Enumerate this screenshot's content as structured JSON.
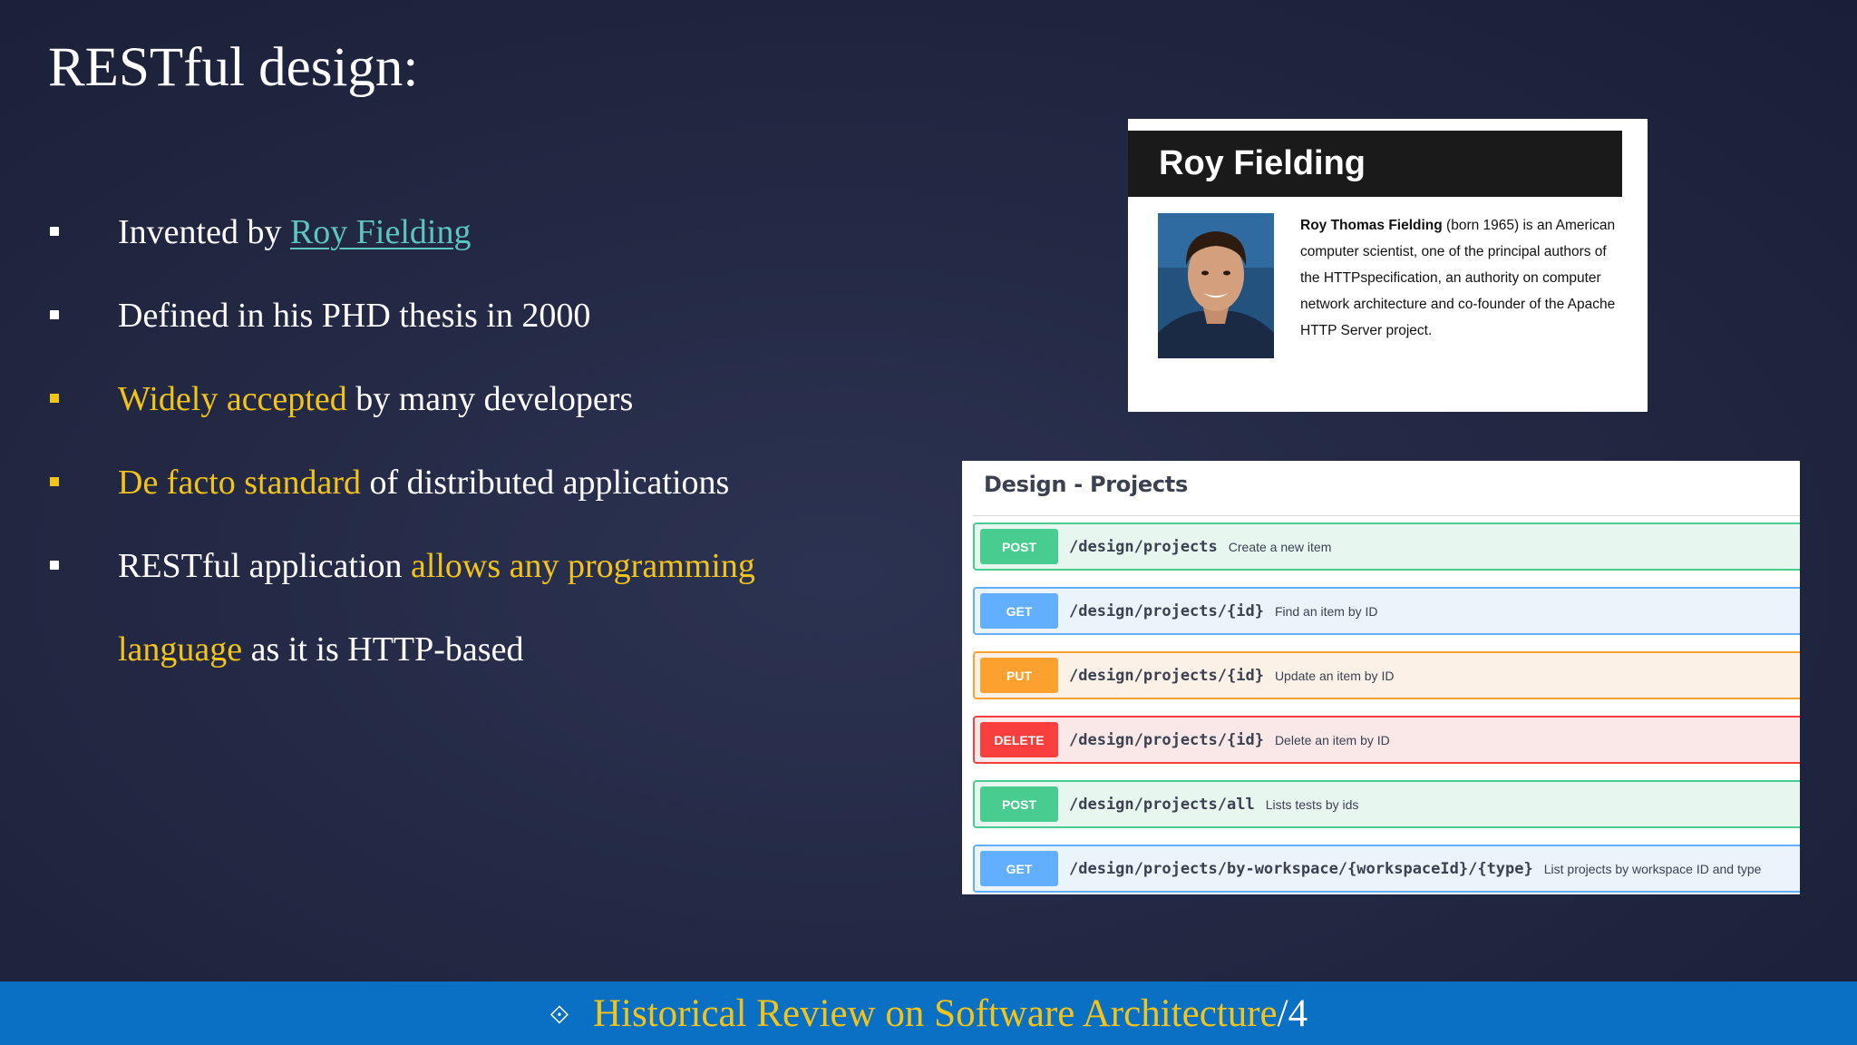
{
  "slide": {
    "title": "RESTful design:"
  },
  "bullets": {
    "b1": {
      "text": "Invented by ",
      "link": "Roy Fielding"
    },
    "b2": {
      "text": "Defined in his PHD thesis in 2000"
    },
    "b3": {
      "hl": "Widely accepted",
      "text": " by many developers"
    },
    "b4": {
      "hl": "De facto standard",
      "text": " of distributed applications"
    },
    "b5": {
      "text": "RESTful application ",
      "hl": "allows any programming"
    },
    "b6": {
      "hl": "language",
      "text": " as it is HTTP-based"
    }
  },
  "wiki_card": {
    "header": "Roy Fielding",
    "name_bold": "Roy Thomas Fielding",
    "description": " (born 1965) is an American computer scientist, one of the principal authors of the HTTPspecification, an authority on computer network architecture and co-founder of the Apache HTTP Server project."
  },
  "api_panel": {
    "title": "Design - Projects",
    "endpoints": [
      {
        "method": "POST",
        "path": "/design/projects",
        "desc": "Create a new item"
      },
      {
        "method": "GET",
        "path": "/design/projects/{id}",
        "desc": "Find an item by ID"
      },
      {
        "method": "PUT",
        "path": "/design/projects/{id}",
        "desc": "Update an item by ID"
      },
      {
        "method": "DELETE",
        "path": "/design/projects/{id}",
        "desc": "Delete an item by ID"
      },
      {
        "method": "POST",
        "path": "/design/projects/all",
        "desc": "Lists tests by ids"
      },
      {
        "method": "GET",
        "path": "/design/projects/by-workspace/{workspaceId}/{type}",
        "desc": "List projects by workspace ID and type"
      }
    ]
  },
  "footer": {
    "icon": "diamond-arrows-icon",
    "text": "Historical Review on Software Architecture",
    "page": "/4"
  },
  "colors": {
    "highlight": "#f2c318",
    "link": "#5cc5c0",
    "footer_bg": "#0a70c4",
    "post": "#49cc90",
    "get": "#61affe",
    "put": "#fca130",
    "delete": "#f93e3e"
  }
}
